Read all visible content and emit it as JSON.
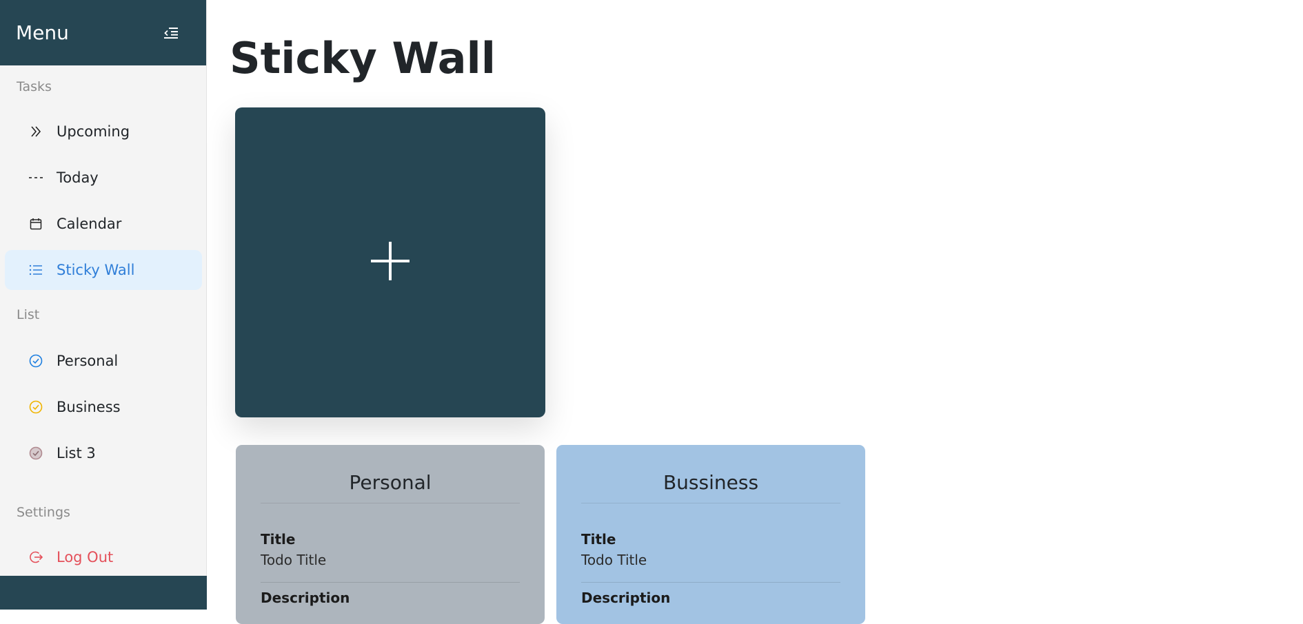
{
  "sidebar": {
    "title": "Menu",
    "toggle_icon": "menu-collapse-icon",
    "sections": {
      "tasks": "Tasks",
      "list": "List",
      "settings": "Settings"
    },
    "tasks": [
      {
        "label": "Upcoming",
        "icon": "double-chevron-right-icon"
      },
      {
        "label": "Today",
        "icon": "dashes-icon"
      },
      {
        "label": "Calendar",
        "icon": "calendar-icon"
      },
      {
        "label": "Sticky Wall",
        "icon": "list-icon",
        "active": true
      }
    ],
    "lists": [
      {
        "label": "Personal",
        "icon": "check-circle-icon",
        "color": "#1e7fe0"
      },
      {
        "label": "Business",
        "icon": "check-circle-icon",
        "color": "#f0b400"
      },
      {
        "label": "List 3",
        "icon": "check-circle-icon",
        "color": "#b08a90"
      }
    ],
    "logout_label": "Log Out",
    "colors": {
      "header": "#264653",
      "active_bg": "#e3f1fd",
      "active_text": "#2f7ed8",
      "logout": "#e4505a"
    }
  },
  "main": {
    "title": "Sticky Wall",
    "add_card": {
      "icon": "plus-icon",
      "color": "#264653"
    },
    "cards": [
      {
        "heading": "Personal",
        "title_label": "Title",
        "title_value": "Todo Title",
        "description_label": "Description",
        "color": "#adb5bd"
      },
      {
        "heading": "Bussiness",
        "title_label": "Title",
        "title_value": "Todo Title",
        "description_label": "Description",
        "color": "#a2c3e3"
      }
    ]
  }
}
